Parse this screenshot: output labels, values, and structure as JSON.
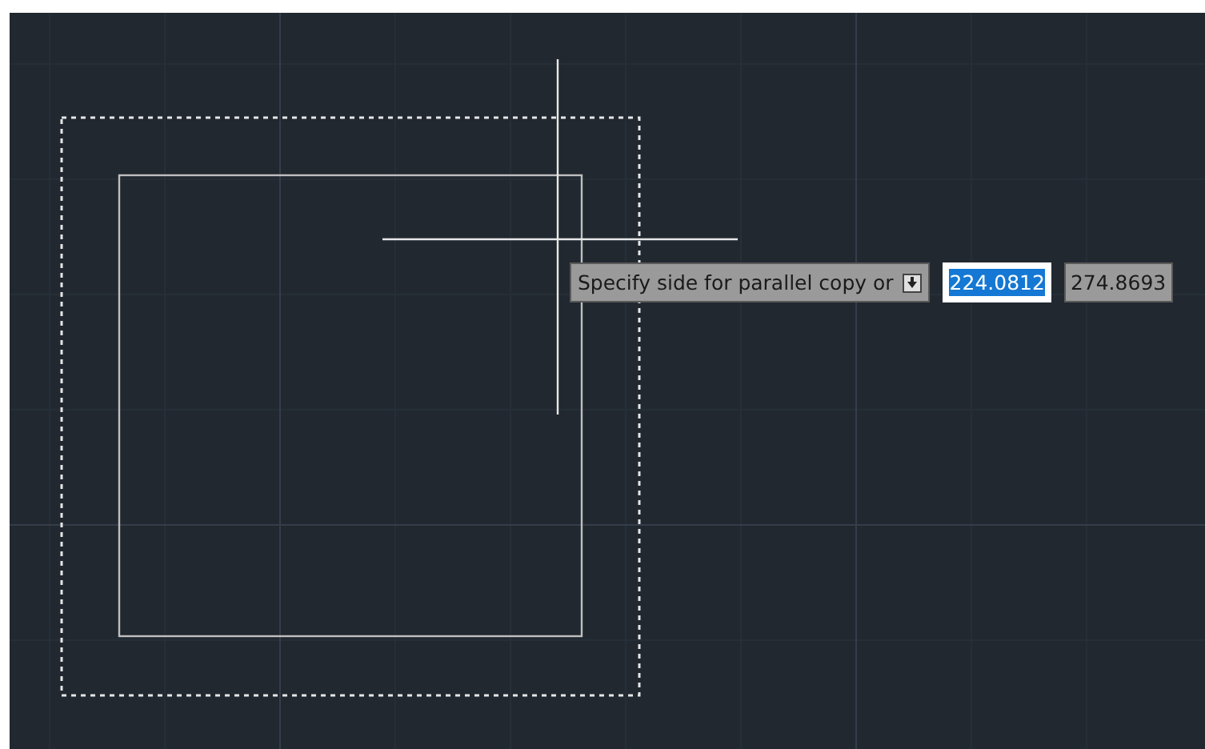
{
  "prompt": {
    "text": "Specify side for parallel copy or"
  },
  "dimension_inputs": [
    {
      "value": "224.0812",
      "selected": true
    },
    {
      "value": "274.8693",
      "selected": false
    }
  ]
}
